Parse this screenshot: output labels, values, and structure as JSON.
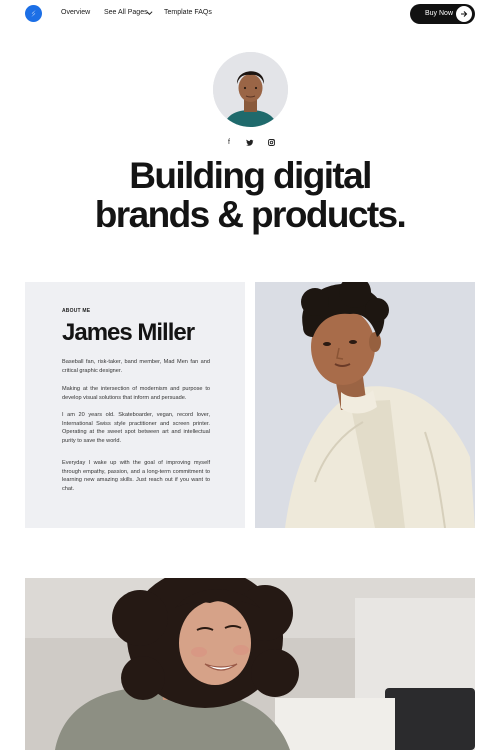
{
  "nav": {
    "logo_icon": "brand-logo-icon",
    "links": [
      "Overview",
      "See All Pages",
      "Template FAQs"
    ],
    "buy_label": "Buy Now"
  },
  "hero": {
    "socials": [
      "f",
      "twitter-icon",
      "instagram-icon"
    ],
    "headline_line1": "Building digital",
    "headline_line2": "brands & products."
  },
  "about": {
    "label": "ABOUT ME",
    "name": "James Miller",
    "paragraphs": [
      "Baseball fan, risk-taker, band member, Mad Men fan and critical graphic designer.",
      "Making at the intersection of modernism and purpose to develop visual solutions that inform and persuade.",
      "I am 20 years old. Skateboarder, vegan, record lover, International Swiss style practitioner and screen printer. Operating at the sweet spot between art and intellectual purity to save the world.",
      "Everyday I wake up with the goal of improving myself through empathy, passion, and a long-term commitment to learning new amazing skills. Just reach out if you want to chat."
    ]
  },
  "colors": {
    "brand": "#1c6fe6",
    "button": "#111111",
    "card_bg": "#eff0f3"
  }
}
